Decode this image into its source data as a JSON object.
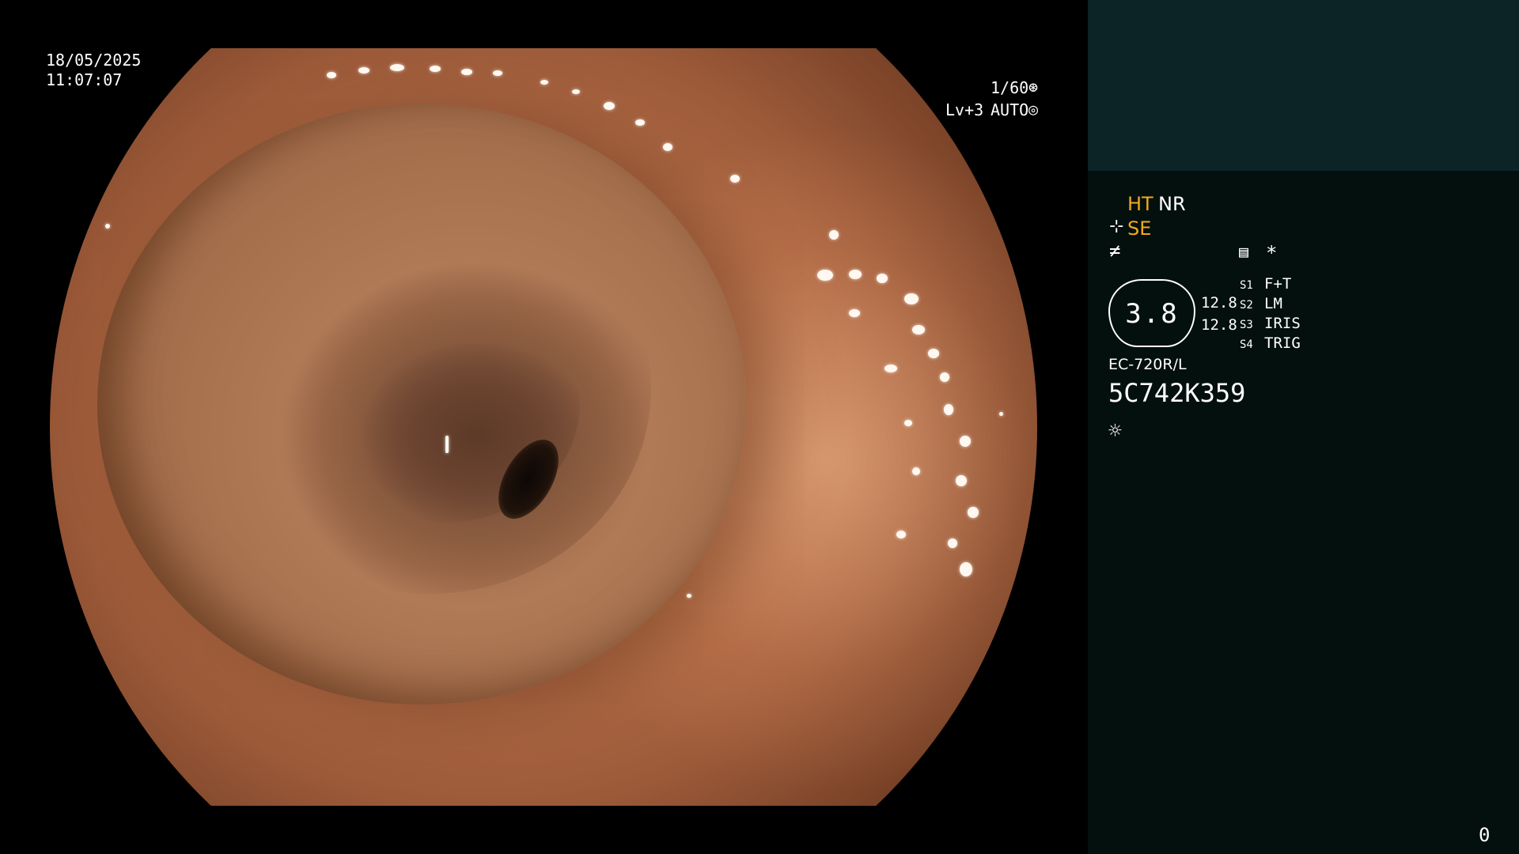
{
  "osd": {
    "date": "18/05/2025",
    "time": "11:07:07",
    "shutter": "1/60",
    "shutter_icon": "shutter-icon",
    "level": "Lv+3",
    "iris": "AUTO",
    "iris_icon": "iris-icon"
  },
  "panel": {
    "modes": {
      "ht": "HT",
      "nr": "NR",
      "se": "SE"
    },
    "icons": [
      "hand-icon",
      "enhance-icon",
      "memo-icon",
      "asterisk-icon",
      "light-icon"
    ],
    "dial_value": "3.8",
    "readout_1": "12.8",
    "readout_2": "12.8",
    "switches": [
      {
        "key": "S1",
        "value": "F+T"
      },
      {
        "key": "S2",
        "value": "LM"
      },
      {
        "key": "S3",
        "value": "IRIS"
      },
      {
        "key": "S4",
        "value": "TRIG"
      }
    ],
    "scope_model": "EC-720R/L",
    "scope_serial": "5C742K359",
    "counter": "0"
  },
  "colors": {
    "accent": "#f2a81e",
    "panel_bg": "#04100e",
    "panel_header": "#0c2426"
  }
}
